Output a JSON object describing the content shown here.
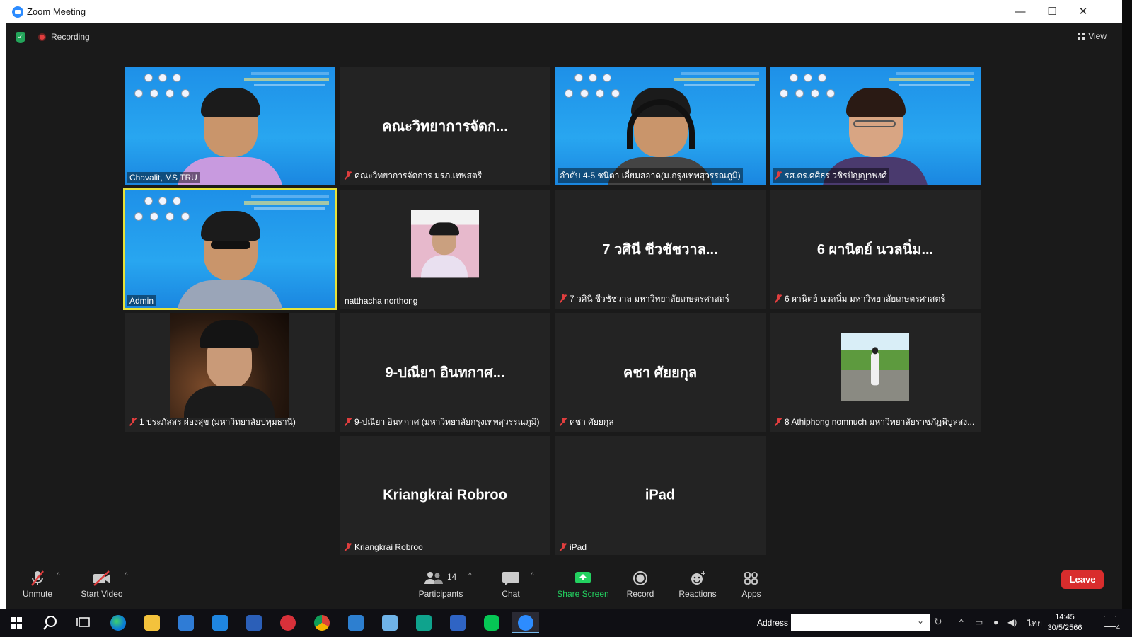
{
  "window": {
    "title": "Zoom Meeting",
    "minimize": "—",
    "maximize": "☐",
    "close": "✕"
  },
  "topbar": {
    "recording_label": "Recording",
    "view_label": "View"
  },
  "tiles": [
    {
      "name": "Chavalit, MS TRU",
      "big": "",
      "muted": false,
      "type": "video-man"
    },
    {
      "name": "คณะวิทยาการจัดการ มรภ.เทพสตรี",
      "big": "คณะวิทยาการจัดก...",
      "muted": true,
      "type": "text"
    },
    {
      "name": "ลำดับ 4-5 ชนิตา เอี่ยมสอาด(ม.กรุงเทพสุวรรณภูมิ)",
      "big": "",
      "muted": false,
      "type": "video-headphones"
    },
    {
      "name": "รศ.ดร.ศศิธร วชิรปัญญาพงศ์",
      "big": "",
      "muted": true,
      "type": "video-woman"
    },
    {
      "name": "Admin",
      "big": "",
      "muted": false,
      "type": "video-glasses"
    },
    {
      "name": "natthacha northong",
      "big": "",
      "muted": false,
      "type": "photo-badge"
    },
    {
      "name": "7 วศินี ชีวชัชวาล มหาวิทยาลัยเกษตรศาสตร์",
      "big": "7 วศินี ชีวชัชวาล...",
      "muted": true,
      "type": "text"
    },
    {
      "name": "6 ผานิตย์  นวลนิ่ม มหาวิทยาลัยเกษตรศาสตร์",
      "big": "6 ผานิตย์  นวลนิ่ม...",
      "muted": true,
      "type": "text"
    },
    {
      "name": "1 ประภัสสร ผ่องสุข (มหาวิทยาลัยปทุมธานี)",
      "big": "",
      "muted": true,
      "type": "photo-girl"
    },
    {
      "name": "9-ปณียา อินทกาศ (มหาวิทยาลัยกรุงเทพสุวรรณภูมิ)",
      "big": "9-ปณียา อินทกาศ...",
      "muted": true,
      "type": "text"
    },
    {
      "name": "คชา ศัยยกุล",
      "big": "คชา ศัยยกุล",
      "muted": true,
      "type": "text"
    },
    {
      "name": "8 Athiphong nomnuch มหาวิทยาลัยราชภัฏพิบูลสง...",
      "big": "",
      "muted": true,
      "type": "photo-park"
    },
    {
      "name": "Kriangkrai Robroo",
      "big": "Kriangkrai Robroo",
      "muted": true,
      "type": "text"
    },
    {
      "name": "iPad",
      "big": "iPad",
      "muted": true,
      "type": "text"
    }
  ],
  "toolbar": {
    "unmute": "Unmute",
    "start_video": "Start Video",
    "participants": "Participants",
    "participants_count": "14",
    "chat": "Chat",
    "share_screen": "Share Screen",
    "record": "Record",
    "reactions": "Reactions",
    "apps": "Apps",
    "leave": "Leave"
  },
  "taskbar": {
    "address_label": "Address",
    "lang": "ไทย",
    "time": "14:45",
    "date": "30/5/2566",
    "notifications": "4"
  },
  "colors": {
    "accent_green": "#23d160",
    "leave_red": "#d92d2d",
    "active_speaker": "#e6e23a",
    "zoom_blue": "#2d8cff"
  }
}
